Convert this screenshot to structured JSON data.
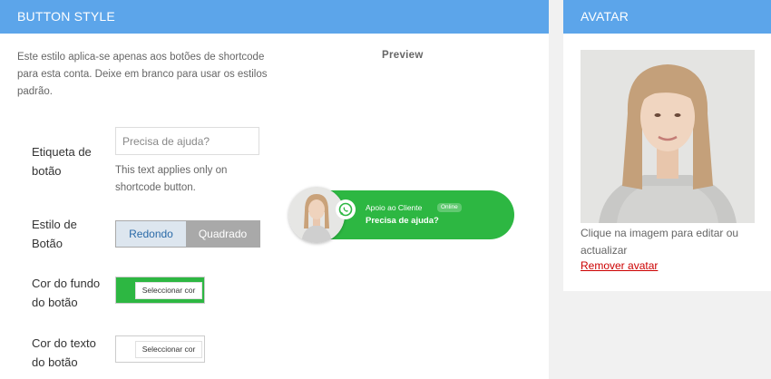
{
  "button_style": {
    "header": "BUTTON STYLE",
    "description": "Este estilo aplica-se apenas aos botões de shortcode para esta conta. Deixe em branco para usar os estilos padrão.",
    "preview_label": "Preview",
    "fields": {
      "label": {
        "label": "Etiqueta de botão",
        "placeholder": "Precisa de ajuda?",
        "hint": "This text applies only on shortcode button."
      },
      "style": {
        "label": "Estilo de Botão",
        "options": [
          "Redondo",
          "Quadrado"
        ],
        "selected": "Redondo"
      },
      "bg_color": {
        "label": "Cor do fundo do botão",
        "button_label": "Seleccionar cor",
        "color": "#2db742"
      },
      "text_color": {
        "label": "Cor do texto do botão",
        "button_label": "Seleccionar cor",
        "color": "#ffffff"
      }
    },
    "preview": {
      "title": "Apoio ao Cliente",
      "badge": "Online",
      "subtitle": "Precisa de ajuda?",
      "icon": "whatsapp-icon",
      "button_color": "#2db742"
    }
  },
  "avatar": {
    "header": "AVATAR",
    "caption": "Clique na imagem para editar ou actualizar",
    "remove_label": "Remover avatar"
  },
  "colors": {
    "header_bg": "#5ca5ea",
    "page_bg": "#f1f1f1",
    "remove_link": "#cc0000"
  }
}
